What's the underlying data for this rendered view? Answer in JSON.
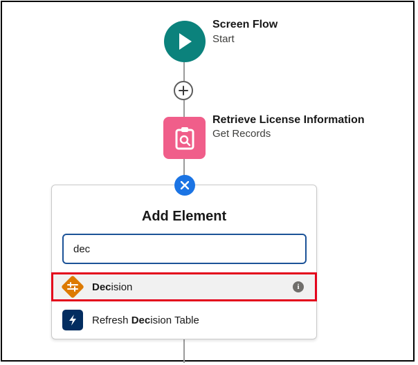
{
  "start_node": {
    "title": "Screen Flow",
    "subtitle": "Start",
    "icon": "play-icon",
    "color": "#0b827c"
  },
  "get_records_node": {
    "title": "Retrieve License Information",
    "subtitle": "Get Records",
    "icon": "clipboard-search-icon",
    "color": "#f05e8a"
  },
  "add_element_panel": {
    "title": "Add Element",
    "search_value": "dec",
    "results": [
      {
        "prefix": "",
        "match": "Dec",
        "suffix": "ision",
        "icon": "decision-diamond-icon",
        "color": "#dd7a01",
        "highlighted": true
      },
      {
        "prefix": "Refresh ",
        "match": "Dec",
        "suffix": "ision Table",
        "icon": "lightning-bolt-icon",
        "color": "#032d60",
        "highlighted": false
      }
    ]
  },
  "colors": {
    "accent_blue": "#1b74e4",
    "highlight_red": "#e3001b",
    "input_border": "#1b5297"
  }
}
